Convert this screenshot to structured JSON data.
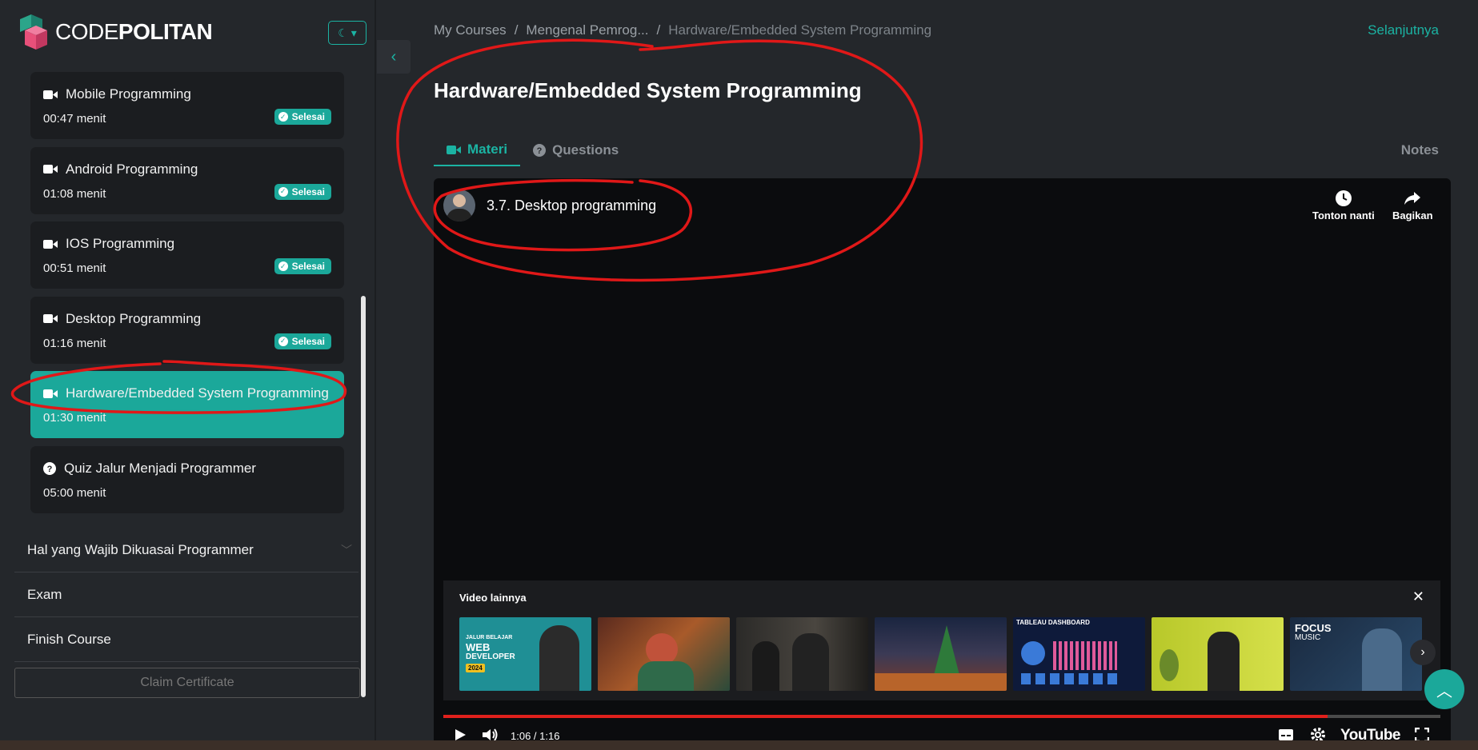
{
  "app": {
    "logo_text_light": "CODE",
    "logo_text_bold": "POLITAN",
    "theme_toggle": "☾ ▾"
  },
  "sidebar": {
    "lessons": [
      {
        "title": "Mobile Programming",
        "duration": "00:47 menit",
        "status": "Selesai",
        "icon": "video-icon"
      },
      {
        "title": "Android Programming",
        "duration": "01:08 menit",
        "status": "Selesai",
        "icon": "video-icon"
      },
      {
        "title": "IOS Programming",
        "duration": "00:51 menit",
        "status": "Selesai",
        "icon": "video-icon"
      },
      {
        "title": "Desktop Programming",
        "duration": "01:16 menit",
        "status": "Selesai",
        "icon": "video-icon"
      },
      {
        "title": "Hardware/Embedded System Programming",
        "duration": "01:30 menit",
        "status": "",
        "icon": "video-icon",
        "active": true
      },
      {
        "title": "Quiz Jalur Menjadi Programmer",
        "duration": "05:00 menit",
        "status": "",
        "icon": "question-icon"
      }
    ],
    "sections": [
      {
        "label": "Hal yang Wajib Dikuasai Programmer"
      },
      {
        "label": "Exam"
      },
      {
        "label": "Finish Course"
      }
    ],
    "claim_label": "Claim Certificate"
  },
  "breadcrumb": {
    "items": [
      "My Courses",
      "/",
      "Mengenal Pemrog...",
      "/",
      "Hardware/Embedded System Programming"
    ]
  },
  "header": {
    "next_label": "Selanjutnya",
    "title": "Hardware/Embedded System Programming"
  },
  "tabs": [
    {
      "label": "Materi"
    },
    {
      "label": "Questions"
    }
  ],
  "notes_label": "Notes",
  "video": {
    "title": "3.7. Desktop programming",
    "watch_later": "Tonton nanti",
    "share": "Bagikan",
    "more_title": "Video lainnya",
    "time": "1:06 / 1:16",
    "progress": 0.887,
    "brand": "YouTube",
    "thumb_texts": {
      "t1a": "JALUR BELAJAR",
      "t1b": "WEB",
      "t1c": "DEVELOPER",
      "t1d": "2024",
      "t5": "TABLEAU DASHBOARD",
      "t7a": "FOCUS",
      "t7b": "MUSIC"
    }
  },
  "colors": {
    "accent": "#1ba89a",
    "progress": "#e0201c",
    "annotation": "#e01818"
  }
}
